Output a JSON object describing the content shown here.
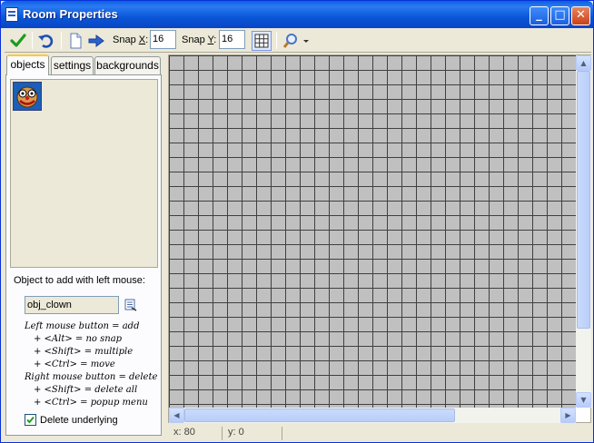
{
  "window": {
    "title": "Room Properties"
  },
  "titlebar": {
    "minimize_glyph": "_",
    "maximize_glyph": "□",
    "close_glyph": "✕"
  },
  "toolbar": {
    "snap_x_label": "Snap ",
    "snap_x_key": "X",
    "snap_x_colon": ":",
    "snap_x_value": "16",
    "snap_y_label": "Snap ",
    "snap_y_key": "Y",
    "snap_y_colon": ":",
    "snap_y_value": "16"
  },
  "tabs": [
    {
      "label": "objects"
    },
    {
      "label": "settings"
    },
    {
      "label": "backgrounds"
    }
  ],
  "objects_panel": {
    "add_label": "Object to add with left mouse:",
    "selected_object": "obj_clown",
    "help_lines": [
      "Left mouse button = add",
      "+ <Alt> = no snap",
      "+ <Shift> = multiple",
      "+ <Ctrl> = move",
      "Right mouse button = delete",
      "+ <Shift> = delete all",
      "+ <Ctrl> = popup menu"
    ],
    "delete_underlying_label": "Delete underlying",
    "delete_underlying_checked": true
  },
  "room": {
    "grid_color": "#404040",
    "background_color": "#C0C0C0"
  },
  "status": {
    "x": "x: 80",
    "y": "y: 0"
  }
}
